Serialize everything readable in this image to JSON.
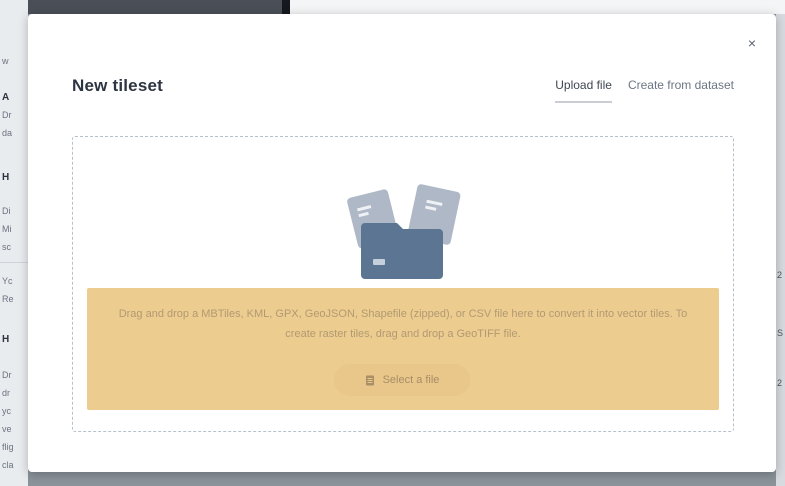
{
  "background": {
    "left_fragments": [
      "w",
      "A",
      "Dr",
      "da",
      "H",
      "Di",
      "Mi",
      "sc",
      "Yc",
      "Re",
      "H",
      "Dr",
      "dr",
      "yc",
      "ve",
      "flig",
      "cla"
    ],
    "right_fragments": [
      "2",
      "S",
      "2"
    ]
  },
  "modal": {
    "close_label": "×",
    "title": "New tileset",
    "tabs": [
      {
        "label": "Upload file",
        "active": true
      },
      {
        "label": "Create from dataset",
        "active": false
      }
    ],
    "dropzone": {
      "message": "Drag and drop a MBTiles, KML, GPX, GeoJSON, Shapefile (zipped), or CSV file here to convert it into vector tiles. To create raster tiles, drag and drop a GeoTIFF file.",
      "select_button": {
        "label": "Select a file",
        "icon": "file-icon"
      },
      "illustration": "files-folder-illustration"
    }
  },
  "colors": {
    "notice_bg": "#edcc8f",
    "folder": "#5b7592",
    "paper": "#aeb8c6"
  }
}
